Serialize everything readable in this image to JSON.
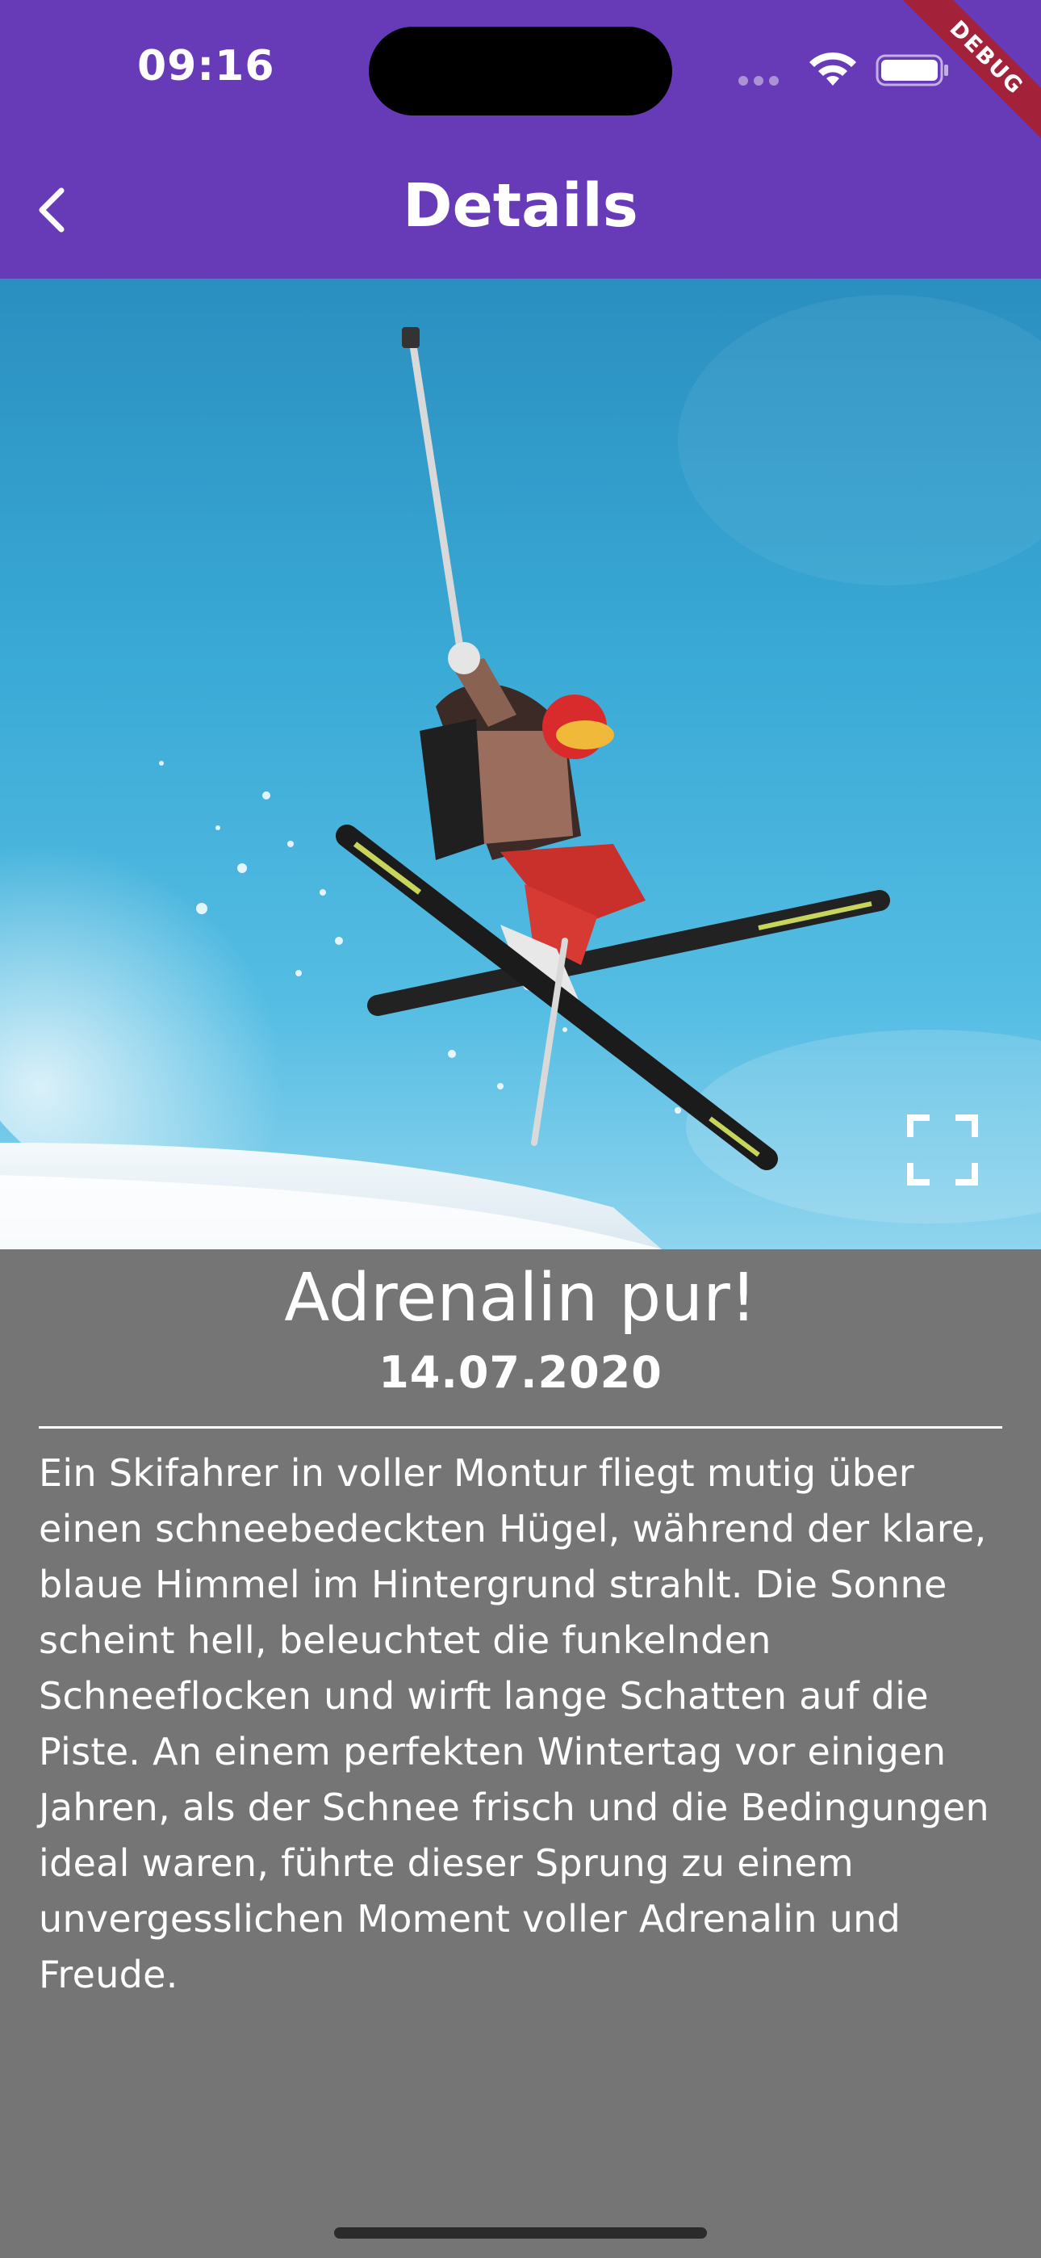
{
  "status_bar": {
    "time": "09:16"
  },
  "debug_banner": {
    "label": "DEBUG"
  },
  "app_bar": {
    "title": "Details",
    "back_icon": "chevron-left-icon",
    "color": "#673AB7"
  },
  "photo": {
    "fullscreen_icon": "fullscreen-icon"
  },
  "details": {
    "title": "Adrenalin pur!",
    "date": "14.07.2020",
    "description": "Ein Skifahrer in voller Montur fliegt mutig über einen schneebedeckten Hügel, während der klare, blaue Himmel im Hintergrund strahlt. Die Sonne scheint hell, beleuchtet die funkelnden Schneeflocken und wirft lange Schatten auf die Piste. An einem perfekten Wintertag vor einigen Jahren, als der Schnee frisch und die Bedingungen ideal waren, führte dieser Sprung zu einem unvergesslichen Moment voller Adrenalin und Freude."
  },
  "colors": {
    "background": "#757575",
    "text": "#FFFFFF",
    "debug": "#A3223A"
  }
}
